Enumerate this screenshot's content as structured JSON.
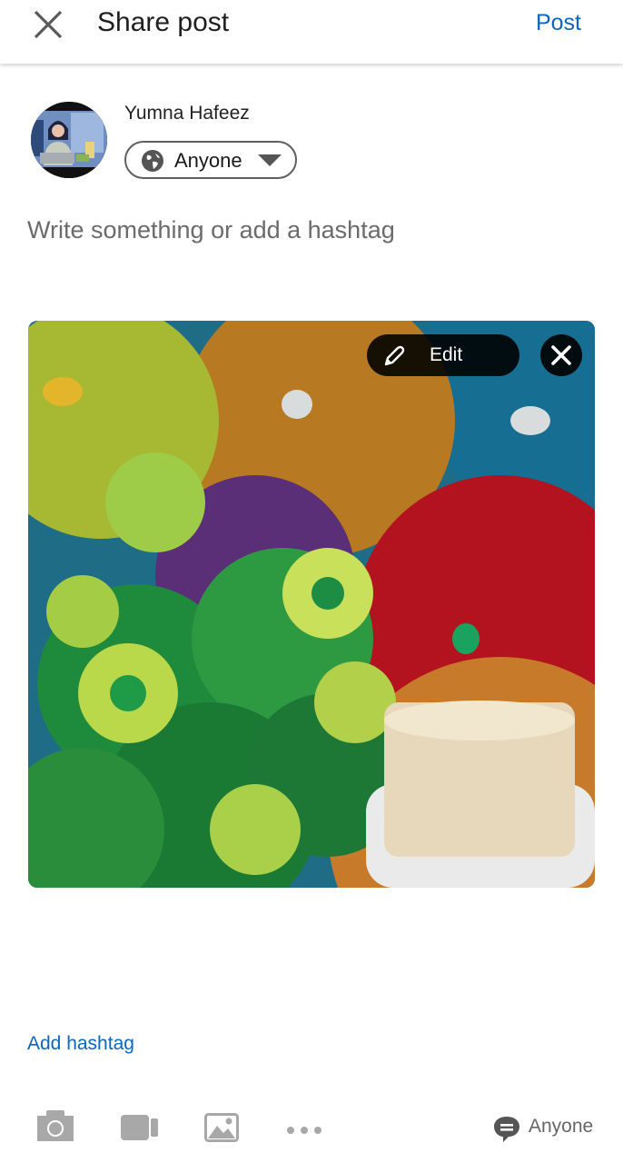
{
  "header": {
    "title": "Share post",
    "post_label": "Post",
    "close_icon": "close-icon"
  },
  "author": {
    "name": "Yumna Hafeez",
    "audience_label": "Anyone",
    "audience_icon": "globe-icon"
  },
  "composer": {
    "placeholder": "Write something or add a hashtag",
    "value": ""
  },
  "attachment": {
    "edit_label": "Edit",
    "edit_icon": "pencil-icon",
    "remove_icon": "close-icon"
  },
  "footer": {
    "add_hashtag_label": "Add hashtag",
    "tools": [
      "camera-icon",
      "video-icon",
      "image-icon",
      "more-icon"
    ],
    "comment_visibility_label": "Anyone",
    "comment_visibility_icon": "comment-icon"
  },
  "colors": {
    "accent": "#0a66c2",
    "icon_gray": "#a8a8a8",
    "text_gray": "#6b6b6b"
  }
}
